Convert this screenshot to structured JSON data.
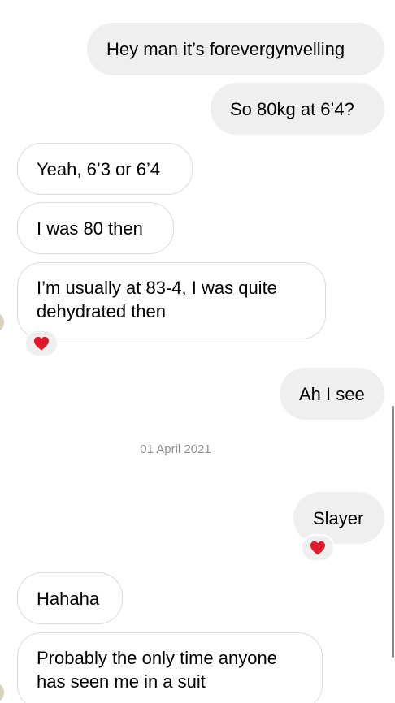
{
  "messages": {
    "m1": "Hey man it’s forevergynvelling",
    "m2": "So 80kg at 6’4?",
    "m3": "Yeah, 6’3 or 6’4",
    "m4": "I was 80 then",
    "m5_line1": "I’m usually at 83-4, I was quite",
    "m5_line2": "dehydrated then",
    "m6": "Ah I see",
    "m7": "Slayer",
    "m8": "Hahaha",
    "m9_line1": "Probably the only time anyone",
    "m9_line2": "has seen me in a suit"
  },
  "date_separator": "01 April 2021",
  "reactions": {
    "m5": "heart-icon",
    "m7": "heart-icon"
  },
  "colors": {
    "sent_bubble": "#efefef",
    "received_border": "#dbdbdb",
    "heart": "#e0192b",
    "date_text": "#8e8e8e"
  }
}
